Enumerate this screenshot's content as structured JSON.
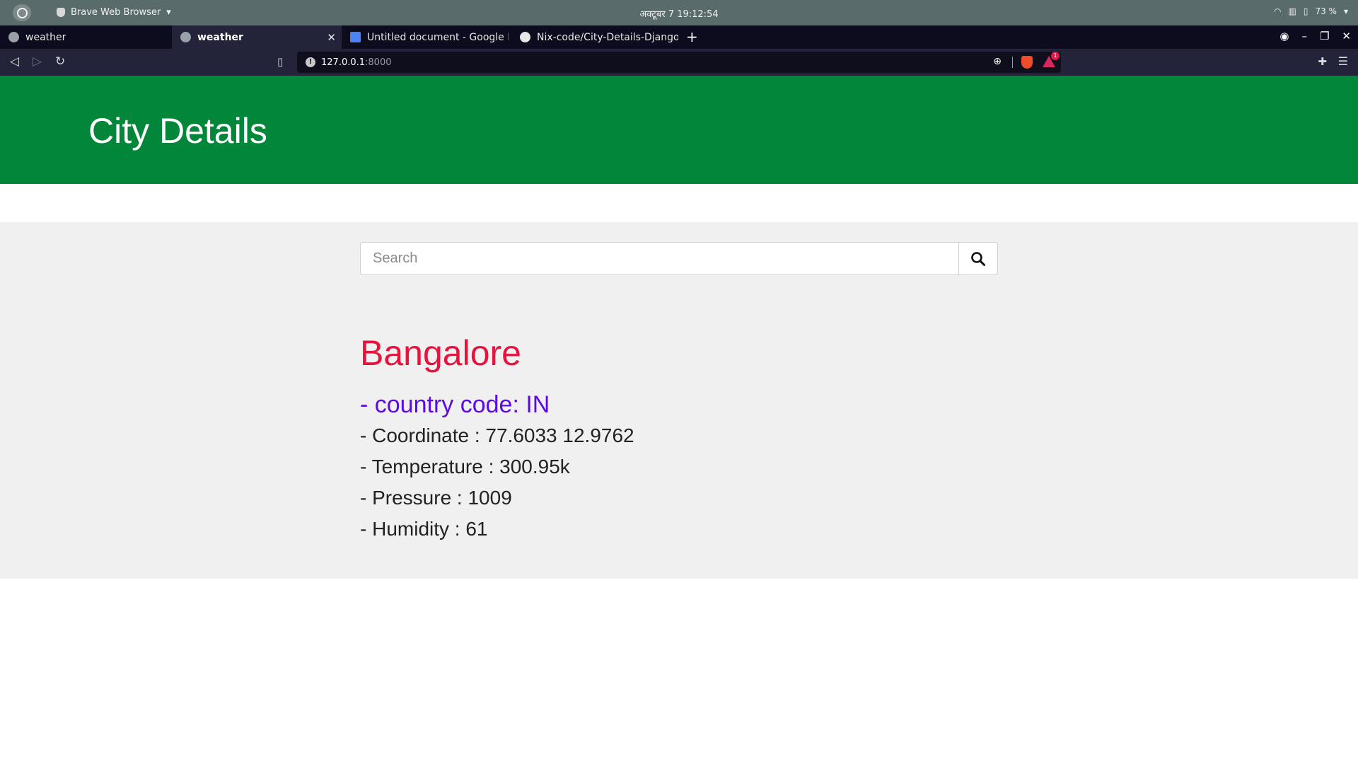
{
  "system": {
    "app_name": "Brave Web Browser",
    "clock": "अक्टूबर 7  19:12:54",
    "battery": "73 %"
  },
  "tabs": [
    {
      "title": "weather",
      "active": false
    },
    {
      "title": "weather",
      "active": true
    },
    {
      "title": "Untitled document - Google D",
      "active": false
    },
    {
      "title": "Nix-code/City-Details-Django-",
      "active": false
    }
  ],
  "toolbar": {
    "url_host": "127.0.0.1",
    "url_port": ":8000",
    "rewards_badge": "1"
  },
  "page": {
    "header_title": "City Details",
    "search_placeholder": "Search",
    "city_name": "Bangalore",
    "country_code": "- country code: IN",
    "details": [
      "- Coordinate : 77.6033 12.9762",
      "- Temperature : 300.95k",
      "- Pressure : 1009",
      "- Humidity : 61"
    ]
  },
  "colors": {
    "header_bg": "#02873a",
    "city_name": "#e8133c",
    "country_code": "#5b0ce6",
    "content_bg": "#f0f0f0"
  }
}
